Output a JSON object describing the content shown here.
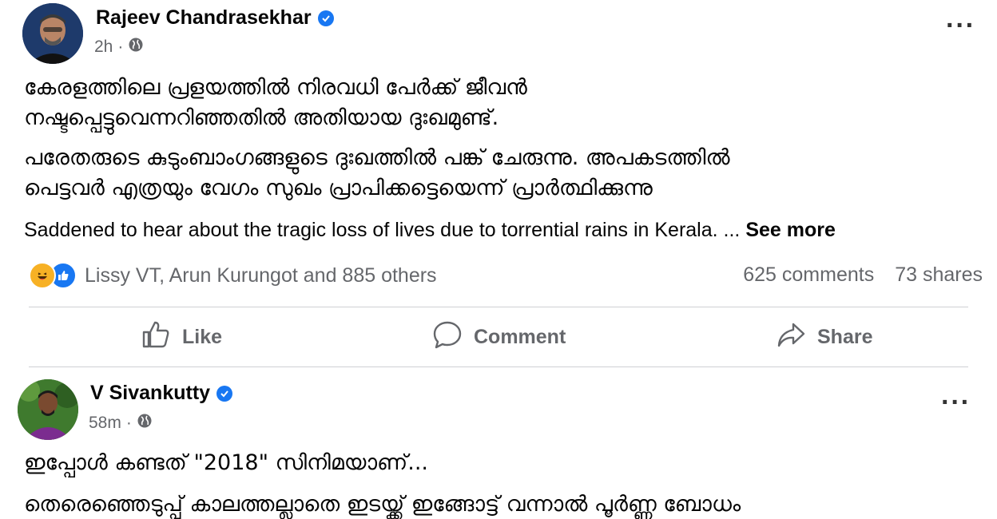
{
  "posts": [
    {
      "author": "Rajeev Chandrasekhar",
      "time": "2h",
      "malayalam_lines": [
        "കേരളത്തിലെ പ്രളയത്തിൽ നിരവധി പേർക്ക് ജീവൻ",
        "നഷ്ടപ്പെട്ടുവെന്നറിഞ്ഞതിൽ അതിയായ ദുഃഖമുണ്ട്.",
        "പരേതരുടെ കുടുംബാംഗങ്ങളുടെ ദുഃഖത്തിൽ പങ്ക് ചേരുന്നു. അപകടത്തിൽ",
        "പെട്ടവർ എത്രയും വേഗം സുഖം പ്രാപിക്കട്ടെയെന്ന് പ്രാർത്ഥിക്കുന്നു"
      ],
      "english_text": "Saddened to hear about the tragic loss of lives due to torrential rains in Kerala. ...",
      "see_more": "See more",
      "reactions_text": "Lissy VT, Arun Kurungot and 885 others",
      "comments": "625 comments",
      "shares": "73 shares",
      "actions": {
        "like": "Like",
        "comment": "Comment",
        "share": "Share"
      }
    },
    {
      "author": "V Sivankutty",
      "time": "58m",
      "malayalam_lines": [
        "ഇപ്പോൾ കണ്ടത്  \"2018\" സിനിമയാണ്...",
        "തെരെഞ്ഞെടുപ്പ് കാലത്തല്ലാതെ ഇടയ്ക്ക് ഇങ്ങോട്ട് വന്നാൽ പൂർണ്ണ ബോധം"
      ]
    }
  ],
  "colors": {
    "verified": "#1877f2",
    "secondary_text": "#65676b",
    "divider": "#ced0d4",
    "haha": "#f7b125",
    "like": "#1877f2"
  },
  "icons": {
    "globe": "globe-icon",
    "verified": "verified-badge-icon",
    "more": "more-options-icon",
    "like": "thumbs-up-icon",
    "comment": "comment-bubble-icon",
    "share": "share-arrow-icon"
  }
}
